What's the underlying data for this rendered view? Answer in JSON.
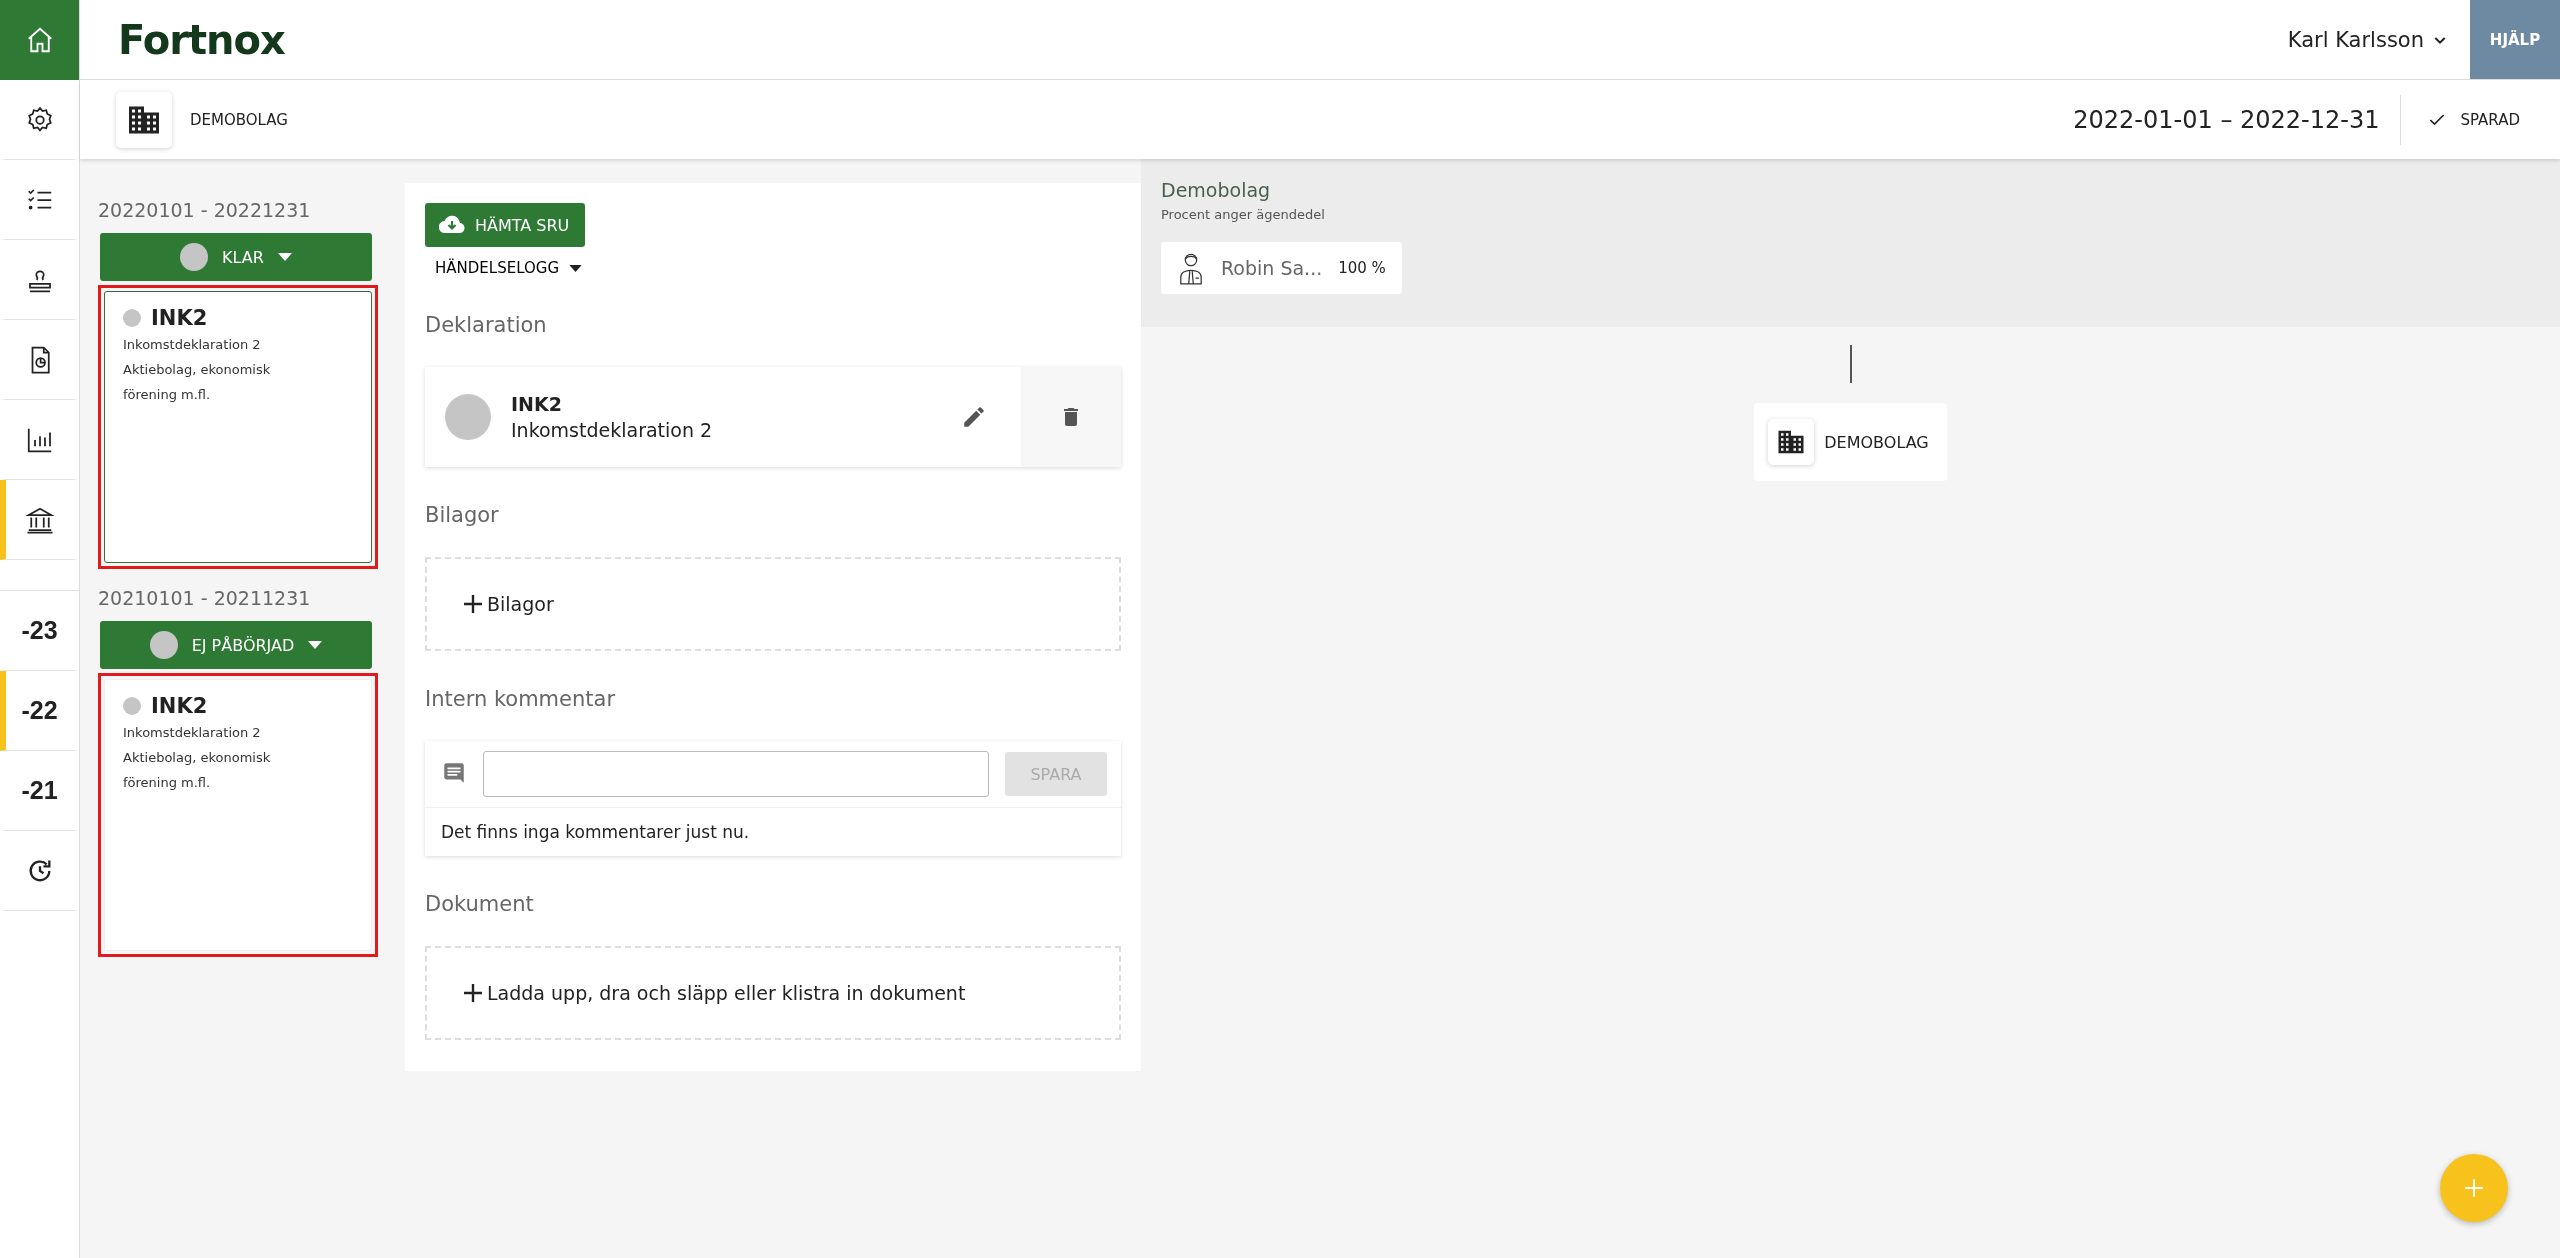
{
  "header": {
    "logo": "Fortnox",
    "user": "Karl Karlsson",
    "help": "HJÄLP"
  },
  "rail": [
    {
      "kind": "icon",
      "selected": false
    },
    {
      "kind": "icon",
      "selected": false
    },
    {
      "kind": "icon",
      "selected": false
    },
    {
      "kind": "icon",
      "selected": false
    },
    {
      "kind": "icon",
      "selected": false
    },
    {
      "kind": "icon",
      "selected": true
    },
    {
      "kind": "year",
      "label": "-23",
      "selected": false
    },
    {
      "kind": "year",
      "label": "-22",
      "selected": true
    },
    {
      "kind": "year",
      "label": "-21",
      "selected": false
    },
    {
      "kind": "icon",
      "selected": false
    }
  ],
  "subheader": {
    "company": "DEMOBOLAG",
    "period": "2022-01-01 – 2022-12-31",
    "saved": "SPARAD"
  },
  "periods": [
    {
      "range": "20220101 - 20221231",
      "status": "KLAR",
      "card": {
        "code": "INK2",
        "title": "Inkomstdeklaration 2",
        "subtitle": "Aktiebolag, ekonomisk förening m.fl.",
        "selected": true,
        "highlighted": true
      }
    },
    {
      "range": "20210101 - 20211231",
      "status": "EJ PÅBÖRJAD",
      "card": {
        "code": "INK2",
        "title": "Inkomstdeklaration 2",
        "subtitle": "Aktiebolag, ekonomisk förening m.fl.",
        "selected": false,
        "highlighted": true
      }
    }
  ],
  "main": {
    "download": "HÄMTA SRU",
    "log": "HÄNDELSELOGG",
    "declaration_heading": "Deklaration",
    "declaration": {
      "code": "INK2",
      "title": "Inkomstdeklaration 2"
    },
    "attachments_heading": "Bilagor",
    "attachments_add": "Bilagor",
    "comment_heading": "Intern kommentar",
    "comment_save": "SPARA",
    "comment_empty": "Det finns inga kommentarer just nu.",
    "documents_heading": "Dokument",
    "documents_add": "Ladda upp, dra och släpp eller klistra in dokument"
  },
  "ownership": {
    "title": "Demobolag",
    "hint": "Procent anger ägendedel",
    "owner": {
      "name": "Robin Sa...",
      "share": "100 %"
    },
    "company": "DEMOBOLAG"
  }
}
